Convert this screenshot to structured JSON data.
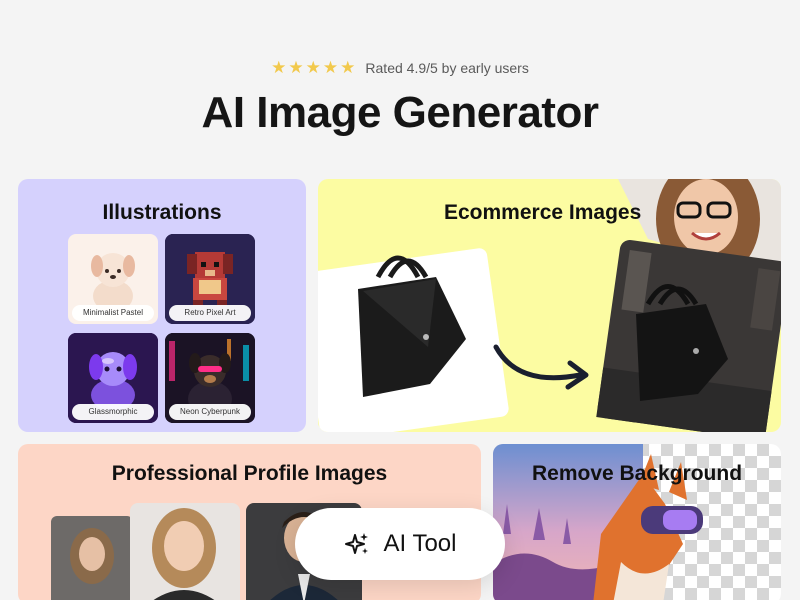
{
  "rating": {
    "stars": [
      "★",
      "★",
      "★",
      "★",
      "★"
    ],
    "text": "Rated 4.9/5 by early users",
    "star_color": "#f2c94c"
  },
  "title": "AI Image Generator",
  "cards": {
    "illustrations": {
      "title": "Illustrations",
      "bg": "#d5d1fd",
      "tiles": [
        {
          "label": "Minimalist Pastel"
        },
        {
          "label": "Retro Pixel Art"
        },
        {
          "label": "Glassmorphic"
        },
        {
          "label": "Neon Cyberpunk"
        }
      ]
    },
    "ecommerce": {
      "title": "Ecommerce Images",
      "bg": "#fcfca2"
    },
    "profile": {
      "title": "Professional Profile Images",
      "bg": "#fdd6c6"
    },
    "remove_background": {
      "title": "Remove Background"
    }
  },
  "cta": {
    "label": "AI Tool",
    "icon": "sparkles-icon"
  }
}
